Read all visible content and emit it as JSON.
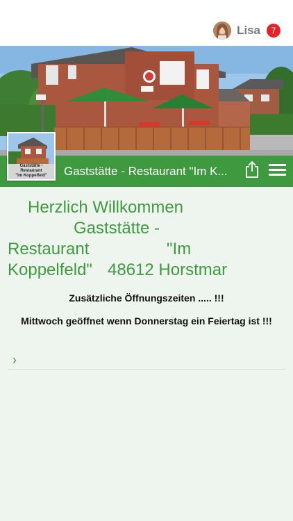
{
  "user": {
    "name": "Lisa",
    "notification_count": "7"
  },
  "header": {
    "title": "Gaststätte - Restaurant \"Im K...",
    "logo_caption_1": "Gaststätte - Restaurant",
    "logo_caption_2": "\"Im Koppelfeld\""
  },
  "content": {
    "welcome_line1": "Herzlich Willkommen",
    "welcome_line2": "Gaststätte -",
    "welcome_line3a": "Restaurant",
    "welcome_line3b": "\"Im",
    "welcome_line4a": "Koppelfeld\"",
    "welcome_line4b": "48612 Horstmar",
    "hours_notice": "Zusätzliche Öffnungszeiten ..... !!!",
    "wednesday_notice": "Mittwoch geöffnet wenn Donnerstag ein Feiertag ist !!!"
  },
  "colors": {
    "accent": "#3f9a3f",
    "badge": "#e3242b",
    "background": "#eef5ee"
  },
  "icons": {
    "share": "share-icon",
    "menu": "hamburger-menu-icon",
    "chevron": "chevron-right-icon"
  }
}
